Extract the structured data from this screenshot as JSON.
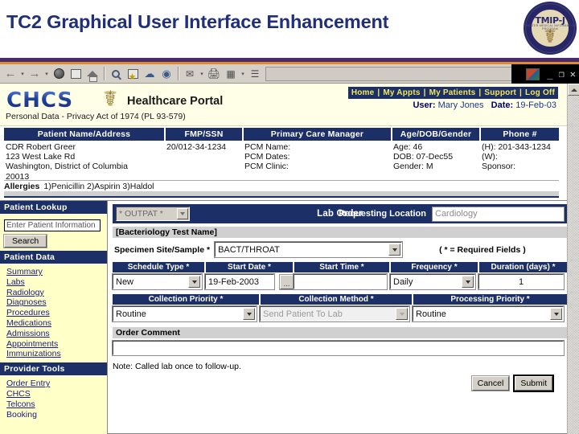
{
  "slide": {
    "title": "TC2 Graphical User Interface Enhancement",
    "logo_text": "TMIP-J",
    "logo_sub": "THEATER MEDICAL INFORMATION PROGRAM",
    "logo_icon": "caduceus-icon",
    "title_color": "#1f2f7a",
    "rule_purple": "#4b2a6e",
    "rule_orange": "#e08b2c"
  },
  "browser": {
    "toolbar": {
      "back": "back-arrow",
      "forward": "forward-arrow",
      "stop": "stop-icon",
      "refresh": "refresh-icon",
      "home": "home-icon",
      "search": "search-icon",
      "favorites": "favorites-icon",
      "history": "history-icon",
      "media": "media-icon",
      "mail": "mail-icon",
      "print": "print-icon",
      "edit": "edit-icon",
      "discuss": "discuss-icon"
    },
    "window_controls": {
      "minimize": "_",
      "restore": "❐",
      "close": "✕"
    }
  },
  "portal": {
    "logo": "CHCS",
    "logo_icon": "caduceus-icon",
    "subtitle": "Healthcare Portal",
    "nav": [
      "Home",
      "My Appts",
      "My Patients",
      "Support",
      "Log Off"
    ],
    "nav_separator": "|",
    "user_label": "User:",
    "user_name": "Mary Jones",
    "date_label": "Date:",
    "date_value": "19-Feb-03",
    "nav_bg": "#1c2f66",
    "nav_fg": "#f2e85a"
  },
  "privacy_notice": "Personal Data - Privacy Act of 1974 (PL 93-579)",
  "patient": {
    "headers": [
      "Patient Name/Address",
      "FMP/SSN",
      "Primary Care Manager",
      "Age/DOB/Gender",
      "Phone #"
    ],
    "name_address": [
      "CDR Robert Greer",
      "123 West Lake Rd",
      "Washington, District of Columbia",
      "20013"
    ],
    "fmp_ssn": "20/012-34-1234",
    "pcm": [
      "PCM Name:",
      "PCM Dates:",
      "PCM Clinic:"
    ],
    "age_dob_gender": [
      "Age: 46",
      "DOB: 07-Dec55",
      "Gender: M"
    ],
    "phone": [
      "(H): 201-343-1234",
      "(W):",
      "Sponsor:"
    ],
    "allergies_label": "Allergies",
    "allergies_value": "1)Penicillin  2)Aspirin  3)Haldol"
  },
  "sidebar": {
    "sections": [
      {
        "title": "Patient Lookup",
        "type": "search",
        "input_value": "Enter Patient Information",
        "button_label": "Search"
      },
      {
        "title": "Patient Data",
        "type": "links",
        "items": [
          "Summary",
          "Labs",
          "Radiology",
          "Diagnoses",
          "Procedures",
          "Medications",
          "Admissions",
          "Appointments",
          "Immunizations"
        ]
      },
      {
        "title": "Provider Tools",
        "type": "links",
        "items": [
          "Order Entry",
          "CHCS",
          "Telcons",
          "Booking"
        ]
      }
    ]
  },
  "order_form": {
    "patient_type_select": "* OUTPAT *",
    "title": "Lab Order",
    "requesting_location_label": "Requesting Location",
    "requesting_location_value": "Cardiology",
    "test_section_title": "[Bacteriology Test Name]",
    "specimen_label": "Specimen Site/Sample *",
    "specimen_value": "BACT/THROAT",
    "required_note": "( * = Required Fields )",
    "schedule": {
      "headers": [
        "Schedule Type *",
        "Start Date *",
        "Start Time *",
        "Frequency *",
        "Duration (days) *"
      ],
      "values": [
        "New",
        "19-Feb-2003",
        "",
        "Daily",
        "1"
      ],
      "date_picker_button": "...",
      "types": [
        "dropdown",
        "date",
        "text",
        "dropdown",
        "text"
      ]
    },
    "priority": {
      "headers": [
        "Collection Priority *",
        "Collection Method *",
        "Processing Priority *"
      ],
      "values": [
        "Routine",
        "Send Patient To Lab",
        "Routine"
      ],
      "disabled": [
        false,
        true,
        false
      ]
    },
    "comment_section_title": "Order Comment",
    "comment_value": "",
    "note": "Note: Called lab once to follow-up.",
    "cancel_label": "Cancel",
    "submit_label": "Submit"
  }
}
